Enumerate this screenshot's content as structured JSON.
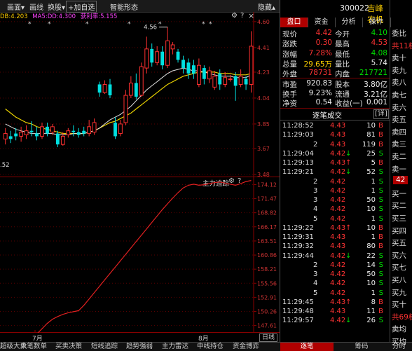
{
  "top_menu": {
    "items": [
      "画面",
      "画线",
      "换股",
      "+加自选",
      "智能形态",
      "隐藏"
    ],
    "icons": [
      "chevron-down-icon",
      "chevron-down-icon",
      "",
      "",
      "",
      "chevron-up-icon"
    ]
  },
  "indicator_line": {
    "ma_label": "DB:4.203",
    "ma2_label": "MA5:DD:4.300",
    "profit_label": "获利率:5.155",
    "gear": "⚙",
    "help": "?",
    "close": "×"
  },
  "kline": {
    "y_ticks": [
      "4.60",
      "4.41",
      "4.23",
      "4.04",
      "3.85",
      "3.67",
      "3.48"
    ],
    "high_mark": "4.56",
    "low_mark": ".52"
  },
  "indicator_panel": {
    "title": "主力追踪",
    "y_ticks": [
      "174.12",
      "171.47",
      "168.82",
      "166.17",
      "163.51",
      "160.86",
      "158.21",
      "155.56",
      "152.91",
      "150.26",
      "147.61"
    ]
  },
  "x_axis": {
    "labels": [
      "7月",
      "8月"
    ],
    "period": "日线"
  },
  "bottom_tabs": [
    "超级大单",
    "大笔数单",
    "买卖决策",
    "短线追踪",
    "趋势强弱",
    "主力雷达",
    "中线持仓",
    "资金博弈",
    "逐笔",
    "筹码",
    "分时"
  ],
  "stock": {
    "code": "300022",
    "name": "吉峰农机"
  },
  "tabs": [
    "盘口",
    "资金",
    "分析",
    "操作"
  ],
  "quote": [
    {
      "l1": "现价",
      "v1": "4.42",
      "c1": "red",
      "l2": "今开",
      "v2": "4.10",
      "c2": "green"
    },
    {
      "l1": "涨跌",
      "v1": "0.30",
      "c1": "red",
      "l2": "最高",
      "v2": "4.53",
      "c2": "red"
    },
    {
      "l1": "涨幅",
      "v1": "7.28%",
      "c1": "red",
      "l2": "最低",
      "v2": "4.08",
      "c2": "green"
    },
    {
      "l1": "总量",
      "v1": "29.65万",
      "c1": "yellow",
      "l2": "量比",
      "v2": "5.74",
      "c2": "white"
    },
    {
      "l1": "外盘",
      "v1": "78731",
      "c1": "red",
      "l2": "内盘",
      "v2": "217721",
      "c2": "green"
    }
  ],
  "fundamentals": [
    {
      "l1": "市盈",
      "v1": "920.83",
      "l2": "股本",
      "v2": "3.80亿"
    },
    {
      "l1": "换手",
      "v1": "9.23%",
      "l2": "流通",
      "v2": "3.21亿"
    },
    {
      "l1": "净资",
      "v1": "0.54",
      "l2": "收益(一)",
      "v2": "0.001"
    }
  ],
  "trades_header": {
    "title": "逐笔成交",
    "detail": "[详]"
  },
  "trades": [
    {
      "time": "11:28:52",
      "price": "4.43",
      "pc": "red",
      "arrow": "",
      "vol": "10",
      "side": "B"
    },
    {
      "time": "11:29:03",
      "price": "4.43",
      "pc": "red",
      "arrow": "",
      "vol": "81",
      "side": "B"
    },
    {
      "time": "2",
      "price": "4.43",
      "pc": "red",
      "arrow": "",
      "vol": "119",
      "side": "B"
    },
    {
      "time": "11:29:04",
      "price": "4.42",
      "pc": "red",
      "arrow": "↓",
      "vol": "25",
      "side": "S"
    },
    {
      "time": "11:29:13",
      "price": "4.43",
      "pc": "red",
      "arrow": "↑",
      "vol": "5",
      "side": "B"
    },
    {
      "time": "11:29:21",
      "price": "4.42",
      "pc": "red",
      "arrow": "↓",
      "vol": "52",
      "side": "S"
    },
    {
      "time": "2",
      "price": "4.42",
      "pc": "red",
      "arrow": "",
      "vol": "1",
      "side": "S"
    },
    {
      "time": "3",
      "price": "4.42",
      "pc": "red",
      "arrow": "",
      "vol": "1",
      "side": "S"
    },
    {
      "time": "3",
      "price": "4.42",
      "pc": "red",
      "arrow": "",
      "vol": "50",
      "side": "S"
    },
    {
      "time": "4",
      "price": "4.42",
      "pc": "red",
      "arrow": "",
      "vol": "10",
      "side": "S"
    },
    {
      "time": "5",
      "price": "4.42",
      "pc": "red",
      "arrow": "",
      "vol": "1",
      "side": "S"
    },
    {
      "time": "11:29:22",
      "price": "4.43",
      "pc": "red",
      "arrow": "↑",
      "vol": "10",
      "side": "B"
    },
    {
      "time": "11:29:31",
      "price": "4.43",
      "pc": "red",
      "arrow": "",
      "vol": "1",
      "side": "B"
    },
    {
      "time": "11:29:32",
      "price": "4.43",
      "pc": "red",
      "arrow": "",
      "vol": "80",
      "side": "B"
    },
    {
      "time": "11:29:44",
      "price": "4.42",
      "pc": "red",
      "arrow": "↓",
      "vol": "22",
      "side": "S"
    },
    {
      "time": "2",
      "price": "4.42",
      "pc": "red",
      "arrow": "",
      "vol": "14",
      "side": "S"
    },
    {
      "time": "3",
      "price": "4.42",
      "pc": "red",
      "arrow": "",
      "vol": "50",
      "side": "S"
    },
    {
      "time": "4",
      "price": "4.42",
      "pc": "red",
      "arrow": "",
      "vol": "10",
      "side": "S"
    },
    {
      "time": "5",
      "price": "4.42",
      "pc": "red",
      "arrow": "",
      "vol": "1",
      "side": "S"
    },
    {
      "time": "11:29:45",
      "price": "4.43",
      "pc": "red",
      "arrow": "↑",
      "vol": "8",
      "side": "B"
    },
    {
      "time": "11:29:48",
      "price": "4.43",
      "pc": "red",
      "arrow": "",
      "vol": "11",
      "side": "B"
    },
    {
      "time": "11:29:57",
      "price": "4.42",
      "pc": "red",
      "arrow": "↓",
      "vol": "26",
      "side": "S"
    }
  ],
  "far_right": {
    "items": [
      {
        "text": "委比",
        "c": "white"
      },
      {
        "text": "共11档",
        "c": "red"
      },
      {
        "text": "卖十",
        "c": "white"
      },
      {
        "text": "卖九",
        "c": "white"
      },
      {
        "text": "卖八",
        "c": "white"
      },
      {
        "text": "卖七",
        "c": "white"
      },
      {
        "text": "卖六",
        "c": "white"
      },
      {
        "text": "卖五",
        "c": "white"
      },
      {
        "text": "卖四",
        "c": "white"
      },
      {
        "text": "卖三",
        "c": "white"
      },
      {
        "text": "卖二",
        "c": "white"
      },
      {
        "text": "卖一",
        "c": "white"
      },
      {
        "text": "42",
        "c": "white"
      },
      {
        "text": "买一",
        "c": "white"
      },
      {
        "text": "买二",
        "c": "white"
      },
      {
        "text": "买三",
        "c": "white"
      },
      {
        "text": "买四",
        "c": "white"
      },
      {
        "text": "买五",
        "c": "white"
      },
      {
        "text": "买六",
        "c": "white"
      },
      {
        "text": "买七",
        "c": "white"
      },
      {
        "text": "买八",
        "c": "white"
      },
      {
        "text": "买九",
        "c": "white"
      },
      {
        "text": "买十",
        "c": "white"
      },
      {
        "text": "共69档",
        "c": "red"
      },
      {
        "text": "卖均",
        "c": "white"
      },
      {
        "text": "买均",
        "c": "white"
      }
    ]
  },
  "chart_data": [
    {
      "type": "candlestick",
      "title": "",
      "ylim": [
        3.48,
        4.62
      ],
      "y_ticks": [
        4.6,
        4.41,
        4.23,
        4.04,
        3.85,
        3.67,
        3.48
      ],
      "candles": [
        {
          "o": 3.74,
          "c": 3.78,
          "h": 3.82,
          "l": 3.7
        },
        {
          "o": 3.76,
          "c": 3.74,
          "h": 3.8,
          "l": 3.71
        },
        {
          "o": 3.78,
          "c": 3.76,
          "h": 3.82,
          "l": 3.73
        },
        {
          "o": 3.76,
          "c": 3.79,
          "h": 3.83,
          "l": 3.72
        },
        {
          "o": 3.77,
          "c": 3.8,
          "h": 3.84,
          "l": 3.74
        },
        {
          "o": 3.8,
          "c": 3.79,
          "h": 3.87,
          "l": 3.76
        },
        {
          "o": 3.78,
          "c": 3.76,
          "h": 3.83,
          "l": 3.73
        },
        {
          "o": 3.76,
          "c": 3.83,
          "h": 3.86,
          "l": 3.74
        },
        {
          "o": 3.83,
          "c": 3.78,
          "h": 3.86,
          "l": 3.76
        },
        {
          "o": 3.79,
          "c": 3.83,
          "h": 3.85,
          "l": 3.77
        },
        {
          "o": 3.78,
          "c": 3.7,
          "h": 3.8,
          "l": 3.68
        },
        {
          "o": 3.7,
          "c": 3.76,
          "h": 3.79,
          "l": 3.69
        },
        {
          "o": 3.77,
          "c": 3.8,
          "h": 3.82,
          "l": 3.75
        },
        {
          "o": 3.8,
          "c": 3.79,
          "h": 3.84,
          "l": 3.76
        },
        {
          "o": 3.79,
          "c": 3.77,
          "h": 3.82,
          "l": 3.75
        },
        {
          "o": 3.8,
          "c": 3.78,
          "h": 3.83,
          "l": 3.76
        },
        {
          "o": 3.78,
          "c": 3.83,
          "h": 3.88,
          "l": 3.76
        },
        {
          "o": 3.79,
          "c": 3.86,
          "h": 3.89,
          "l": 3.77
        },
        {
          "o": 4.14,
          "c": 4.08,
          "h": 4.16,
          "l": 4.05
        },
        {
          "o": 4.08,
          "c": 4.14,
          "h": 4.17,
          "l": 4.07
        },
        {
          "o": 4.14,
          "c": 4.06,
          "h": 4.18,
          "l": 4.04
        },
        {
          "o": 3.86,
          "c": 3.76,
          "h": 3.9,
          "l": 3.74
        },
        {
          "o": 3.78,
          "c": 3.85,
          "h": 3.88,
          "l": 3.76
        },
        {
          "o": 3.86,
          "c": 4.06,
          "h": 4.1,
          "l": 3.84
        },
        {
          "o": 4.06,
          "c": 4.15,
          "h": 4.2,
          "l": 4.04
        },
        {
          "o": 4.15,
          "c": 4.05,
          "h": 4.22,
          "l": 4.03
        },
        {
          "o": 4.06,
          "c": 4.27,
          "h": 4.3,
          "l": 4.05
        },
        {
          "o": 4.26,
          "c": 4.4,
          "h": 4.49,
          "l": 4.22
        },
        {
          "o": 4.4,
          "c": 4.3,
          "h": 4.44,
          "l": 4.27
        },
        {
          "o": 4.3,
          "c": 4.38,
          "h": 4.42,
          "l": 4.28
        },
        {
          "o": 4.38,
          "c": 4.28,
          "h": 4.42,
          "l": 4.25
        },
        {
          "o": 4.28,
          "c": 4.46,
          "h": 4.56,
          "l": 4.26
        },
        {
          "o": 4.4,
          "c": 4.43,
          "h": 4.45,
          "l": 4.36
        },
        {
          "o": 4.38,
          "c": 4.32,
          "h": 4.4,
          "l": 4.3
        },
        {
          "o": 4.32,
          "c": 4.26,
          "h": 4.35,
          "l": 4.22
        },
        {
          "o": 4.3,
          "c": 4.22,
          "h": 4.33,
          "l": 4.18
        },
        {
          "o": 4.28,
          "c": 4.22,
          "h": 4.32,
          "l": 4.18
        },
        {
          "o": 4.14,
          "c": 4.28,
          "h": 4.33,
          "l": 4.12
        },
        {
          "o": 4.26,
          "c": 4.18,
          "h": 4.28,
          "l": 4.14
        },
        {
          "o": 4.18,
          "c": 4.24,
          "h": 4.27,
          "l": 4.15
        },
        {
          "o": 4.12,
          "c": 4.2,
          "h": 4.24,
          "l": 4.1
        },
        {
          "o": 4.22,
          "c": 4.14,
          "h": 4.25,
          "l": 4.1
        },
        {
          "o": 4.14,
          "c": 4.19,
          "h": 4.23,
          "l": 4.12
        },
        {
          "o": 4.18,
          "c": 4.18,
          "h": 4.21,
          "l": 4.16
        },
        {
          "o": 4.2,
          "c": 4.13,
          "h": 4.23,
          "l": 4.02
        },
        {
          "o": 4.14,
          "c": 4.2,
          "h": 4.25,
          "l": 4.12
        },
        {
          "o": 4.18,
          "c": 4.14,
          "h": 4.2,
          "l": 4.1
        },
        {
          "o": 4.14,
          "c": 4.42,
          "h": 4.53,
          "l": 4.08
        }
      ],
      "ma_yellow": [
        3.96,
        3.93,
        3.9,
        3.88,
        3.86,
        3.85,
        3.83,
        3.82,
        3.81,
        3.8,
        3.79,
        3.78,
        3.78,
        3.78,
        3.78,
        3.78,
        3.79,
        3.8,
        3.82,
        3.84,
        3.86,
        3.87,
        3.89,
        3.91,
        3.93,
        3.96,
        3.99,
        4.02,
        4.05,
        4.08,
        4.11,
        4.14,
        4.16,
        4.18,
        4.2,
        4.21,
        4.22,
        4.23,
        4.23,
        4.23,
        4.23,
        4.22,
        4.22,
        4.22,
        4.21,
        4.21,
        4.21,
        4.22
      ],
      "ma_white": [
        3.85,
        3.83,
        3.81,
        3.8,
        3.79,
        3.78,
        3.78,
        3.78,
        3.78,
        3.78,
        3.77,
        3.77,
        3.77,
        3.78,
        3.78,
        3.78,
        3.79,
        3.8,
        3.82,
        3.85,
        3.88,
        3.9,
        3.92,
        3.95,
        3.98,
        4.02,
        4.06,
        4.1,
        4.13,
        4.16,
        4.19,
        4.22,
        4.24,
        4.25,
        4.26,
        4.25,
        4.24,
        4.24,
        4.23,
        4.22,
        4.21,
        4.2,
        4.2,
        4.2,
        4.19,
        4.19,
        4.19,
        4.21
      ]
    },
    {
      "type": "line",
      "title": "主力追踪",
      "ylim": [
        146.5,
        175.5
      ],
      "y_ticks": [
        174.12,
        171.47,
        168.82,
        166.17,
        163.51,
        160.86,
        158.21,
        155.56,
        152.91,
        150.26,
        147.61
      ],
      "series": [
        {
          "values": [
            140.0,
            141.0,
            142.0,
            143.0,
            144.0,
            145.0,
            146.0,
            147.0,
            148.0,
            148.8,
            149.3,
            149.7,
            150.0,
            150.2,
            150.4,
            151.4,
            152.6,
            153.8,
            155.0,
            156.2,
            157.4,
            158.6,
            159.8,
            161.0,
            162.2,
            163.4,
            164.6,
            165.8,
            167.0,
            168.2,
            169.4,
            170.5,
            171.6,
            172.6,
            173.5,
            174.0,
            174.2,
            174.0,
            174.1,
            174.3,
            174.5,
            174.6,
            174.4,
            174.2,
            174.0,
            174.3,
            174.7,
            174.9
          ]
        }
      ]
    }
  ]
}
